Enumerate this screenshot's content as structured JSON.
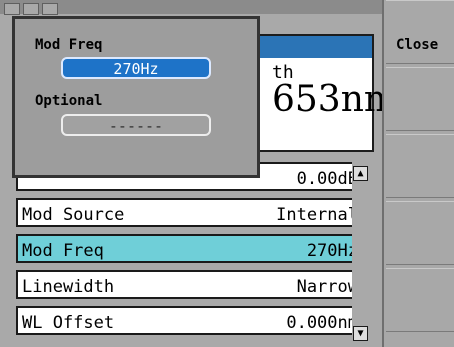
{
  "softkeys": [
    {
      "label": "Close"
    },
    {
      "label": ""
    },
    {
      "label": ""
    },
    {
      "label": ""
    },
    {
      "label": ""
    }
  ],
  "measurement": {
    "title_fragment": "th",
    "value": "653nm"
  },
  "parameters": [
    {
      "label": "",
      "value": "0.00dB"
    },
    {
      "label": "Mod Source",
      "value": "Internal"
    },
    {
      "label": "Mod Freq",
      "value": "270Hz"
    },
    {
      "label": "Linewidth",
      "value": "Narrow"
    },
    {
      "label": "WL Offset",
      "value": "0.000nm"
    }
  ],
  "popup": {
    "field1_label": "Mod Freq",
    "field1_value": "270Hz",
    "field2_label": "Optional",
    "field2_value": "------"
  },
  "scrollbar": {
    "up": "▲",
    "down": "▼"
  },
  "colors": {
    "selected_row": "#6fcfd8",
    "header_blue": "#2b74b6",
    "popup_active": "#1e73c8",
    "background": "#a9a9a9"
  }
}
